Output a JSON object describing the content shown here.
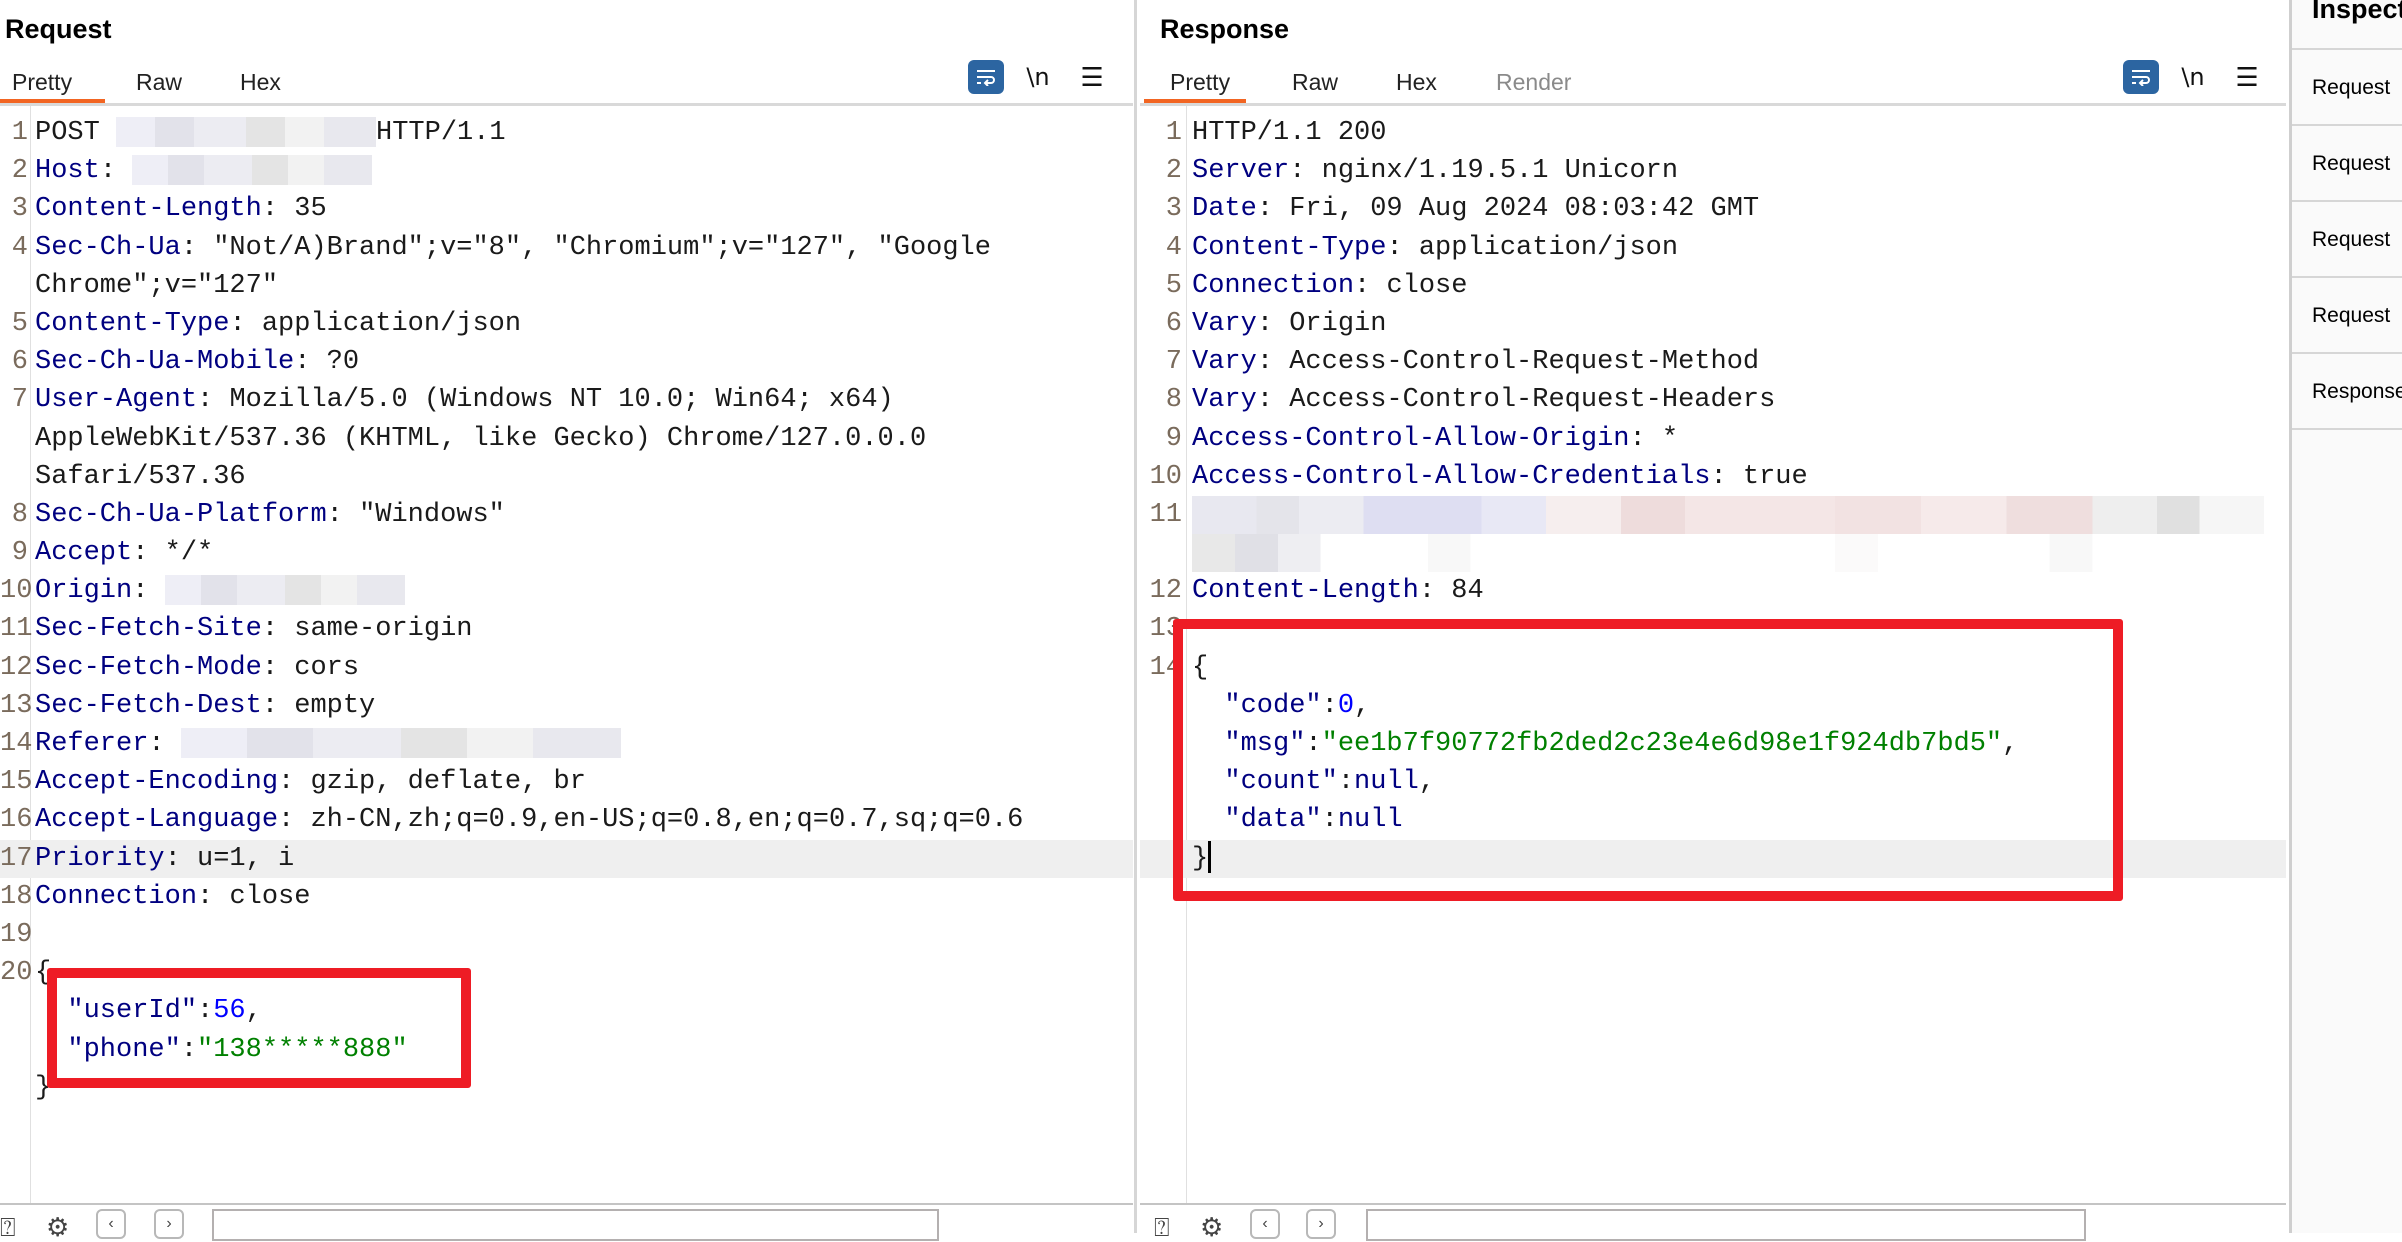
{
  "request": {
    "title": "Request",
    "tabs": [
      {
        "label": "Pretty",
        "active": true
      },
      {
        "label": "Raw",
        "active": false
      },
      {
        "label": "Hex",
        "active": false
      }
    ],
    "toolbar": {
      "wrap_icon": "word-wrap-icon",
      "newline_label": "\\n",
      "menu_icon": "☰"
    },
    "lines": [
      {
        "n": "1",
        "method": "POST",
        "redacted": true,
        "after": "HTTP/1.1"
      },
      {
        "n": "2",
        "key": "Host",
        "redacted": true
      },
      {
        "n": "3",
        "key": "Content-Length",
        "value": "35"
      },
      {
        "n": "4",
        "key": "Sec-Ch-Ua",
        "value": "\"Not/A)Brand\";v=\"8\", \"Chromium\";v=\"127\", \"Google",
        "cont": [
          "Chrome\";v=\"127\""
        ]
      },
      {
        "n": "5",
        "key": "Content-Type",
        "value": "application/json"
      },
      {
        "n": "6",
        "key": "Sec-Ch-Ua-Mobile",
        "value": "?0"
      },
      {
        "n": "7",
        "key": "User-Agent",
        "value": "Mozilla/5.0 (Windows NT 10.0; Win64; x64)",
        "cont": [
          "AppleWebKit/537.36 (KHTML, like Gecko) Chrome/127.0.0.0",
          "Safari/537.36"
        ]
      },
      {
        "n": "8",
        "key": "Sec-Ch-Ua-Platform",
        "value": "\"Windows\""
      },
      {
        "n": "9",
        "key": "Accept",
        "value": "*/*"
      },
      {
        "n": "10",
        "key": "Origin",
        "redacted": true
      },
      {
        "n": "11",
        "key": "Sec-Fetch-Site",
        "value": "same-origin"
      },
      {
        "n": "12",
        "key": "Sec-Fetch-Mode",
        "value": "cors"
      },
      {
        "n": "13",
        "key": "Sec-Fetch-Dest",
        "value": "empty"
      },
      {
        "n": "14",
        "key": "Referer",
        "redacted": true
      },
      {
        "n": "15",
        "key": "Accept-Encoding",
        "value": "gzip, deflate, br"
      },
      {
        "n": "16",
        "key": "Accept-Language",
        "value": "zh-CN,zh;q=0.9,en-US;q=0.8,en;q=0.7,sq;q=0.6"
      },
      {
        "n": "17",
        "key": "Priority",
        "value": "u=1, i",
        "highlight": true
      },
      {
        "n": "18",
        "key": "Connection",
        "value": "close"
      },
      {
        "n": "19"
      },
      {
        "n": "20",
        "raw": "{"
      }
    ],
    "body": [
      {
        "key": "\"userId\"",
        "num": "56",
        "comma": ","
      },
      {
        "key": "\"phone\"",
        "str": "\"138*****888\"",
        "comma": ""
      }
    ],
    "body_close": "}"
  },
  "response": {
    "title": "Response",
    "tabs": [
      {
        "label": "Pretty",
        "active": true
      },
      {
        "label": "Raw",
        "active": false
      },
      {
        "label": "Hex",
        "active": false
      },
      {
        "label": "Render",
        "active": false,
        "disabled": true
      }
    ],
    "toolbar": {
      "wrap_icon": "word-wrap-icon",
      "newline_label": "\\n",
      "menu_icon": "☰"
    },
    "lines": [
      {
        "n": "1",
        "raw": "HTTP/1.1 200"
      },
      {
        "n": "2",
        "key": "Server",
        "value": "nginx/1.19.5.1 Unicorn"
      },
      {
        "n": "3",
        "key": "Date",
        "value": "Fri, 09 Aug 2024 08:03:42 GMT"
      },
      {
        "n": "4",
        "key": "Content-Type",
        "value": "application/json"
      },
      {
        "n": "5",
        "key": "Connection",
        "value": "close"
      },
      {
        "n": "6",
        "key": "Vary",
        "value": "Origin"
      },
      {
        "n": "7",
        "key": "Vary",
        "value": "Access-Control-Request-Method"
      },
      {
        "n": "8",
        "key": "Vary",
        "value": "Access-Control-Request-Headers"
      },
      {
        "n": "9",
        "key": "Access-Control-Allow-Origin",
        "value": "*"
      },
      {
        "n": "10",
        "key": "Access-Control-Allow-Credentials",
        "value": "true"
      },
      {
        "n": "11",
        "redacted_block": true
      },
      {
        "n": "12",
        "key": "Content-Length",
        "value": "84"
      },
      {
        "n": "13"
      },
      {
        "n": "14",
        "raw": "{"
      }
    ],
    "body": [
      {
        "key": "\"code\"",
        "num": "0",
        "comma": ","
      },
      {
        "key": "\"msg\"",
        "str": "\"ee1b7f90772fb2ded2c23e4e6d98e1f924db7bd5\"",
        "comma": ","
      },
      {
        "key": "\"count\"",
        "plain": "null",
        "comma": ","
      },
      {
        "key": "\"data\"",
        "plain": "null",
        "comma": ""
      }
    ],
    "body_close": "}"
  },
  "inspector": {
    "title": "Inspector",
    "rows": [
      "Request",
      "Request",
      "Request",
      "Request",
      "Response"
    ]
  },
  "layout_toggle": {
    "active_index": 0,
    "count": 3
  },
  "colors": {
    "accent_tab": "#f26522",
    "header_key": "#000080",
    "json_number": "#0000ff",
    "json_string": "#008000",
    "highlight_box": "#ee1c25",
    "toolbar_active": "#2c65a1"
  },
  "bottom_bar": {
    "icons": [
      "help-icon",
      "settings-icon",
      "back-arrow-icon",
      "forward-arrow-icon"
    ],
    "search_placeholder": ""
  }
}
